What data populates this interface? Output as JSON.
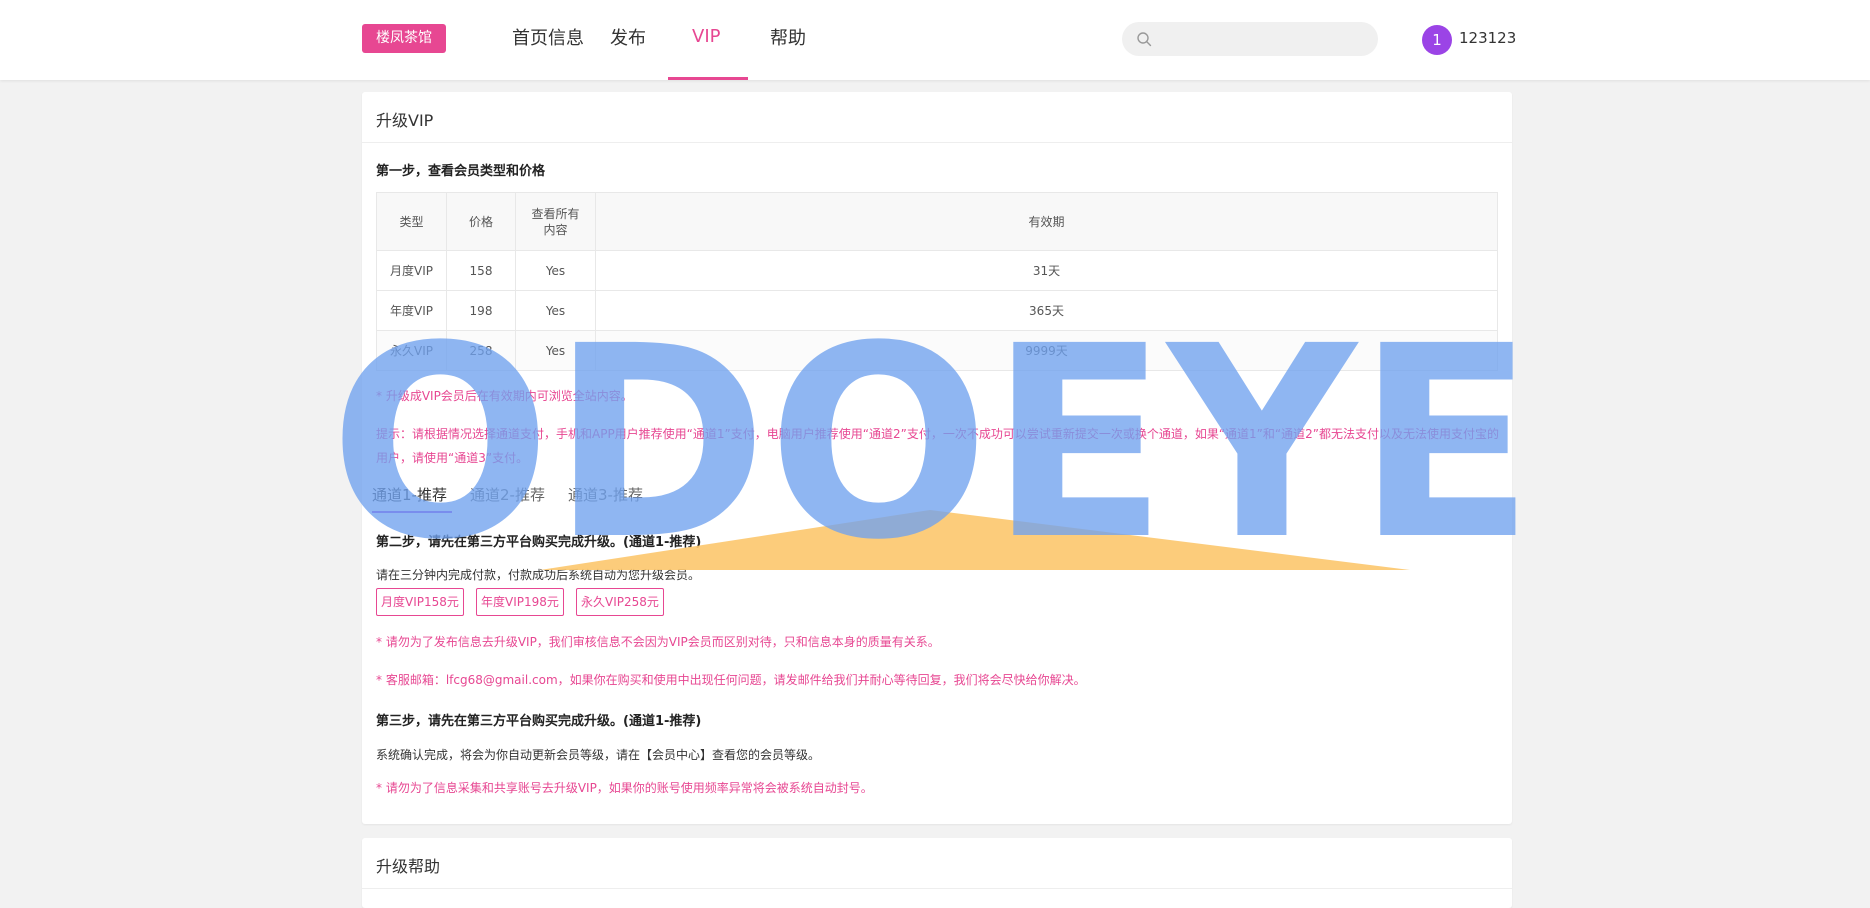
{
  "header": {
    "logo": "楼凤茶馆",
    "nav": [
      {
        "label": "首页信息"
      },
      {
        "label": "发布"
      },
      {
        "label": "VIP"
      },
      {
        "label": "帮助"
      }
    ],
    "search": {
      "placeholder": "",
      "value": ""
    },
    "avatar_text": "1",
    "username": "123123"
  },
  "main": {
    "title": "升级VIP",
    "step1_title": "第一步，查看会员类型和价格",
    "table": {
      "headers": [
        "类型",
        "价格",
        "查看所有内容",
        "有效期"
      ],
      "rows": [
        [
          "月度VIP",
          "158",
          "Yes",
          "31天"
        ],
        [
          "年度VIP",
          "198",
          "Yes",
          "365天"
        ],
        [
          "永久VIP",
          "258",
          "Yes",
          "9999天"
        ]
      ]
    },
    "note1": "* 升级成VIP会员后在有效期内可浏览全站内容。",
    "note2": "提示：请根据情况选择通道支付，手机和APP用户推荐使用“通道1”支付，电脑用户推荐使用“通道2”支付，一次不成功可以尝试重新提交一次或换个通道，如果“通道1”和“通道2”都无法支付以及无法使用支付宝的用户，请使用“通道3”支付。",
    "tabs": [
      {
        "label": "通道1-推荐"
      },
      {
        "label": "通道2-推荐"
      },
      {
        "label": "通道3-推荐"
      }
    ],
    "step2_title": "第二步，请先在第三方平台购买完成升级。(通道1-推荐)",
    "step2_desc": "请在三分钟内完成付款，付款成功后系统自动为您升级会员。",
    "buy_buttons": [
      {
        "label": "月度VIP158元"
      },
      {
        "label": "年度VIP198元"
      },
      {
        "label": "永久VIP258元"
      }
    ],
    "note3": "* 请勿为了发布信息去升级VIP，我们审核信息不会因为VIP会员而区别对待，只和信息本身的质量有关系。",
    "note4_prefix": "* 客服邮箱：",
    "note4_email": "lfcg68@gmail.com",
    "note4_suffix": "，如果你在购买和使用中出现任何问题，请发邮件给我们并耐心等待回复，我们将会尽快给你解决。",
    "step3_title": "第三步，请先在第三方平台购买完成升级。(通道1-推荐)",
    "step3_desc": "系统确认完成，将会为你自动更新会员等级，请在【会员中心】查看您的会员等级。",
    "note5": "* 请勿为了信息采集和共享账号去升级VIP，如果你的账号使用频率异常将会被系统自动封号。"
  },
  "help": {
    "title": "升级帮助"
  },
  "watermark": {
    "text": "ODOEYE",
    "color_text": "#6fa2ee",
    "color_roof": "#fcc66d"
  },
  "colors": {
    "accent": "#e74792",
    "purple": "#9b44e6"
  }
}
